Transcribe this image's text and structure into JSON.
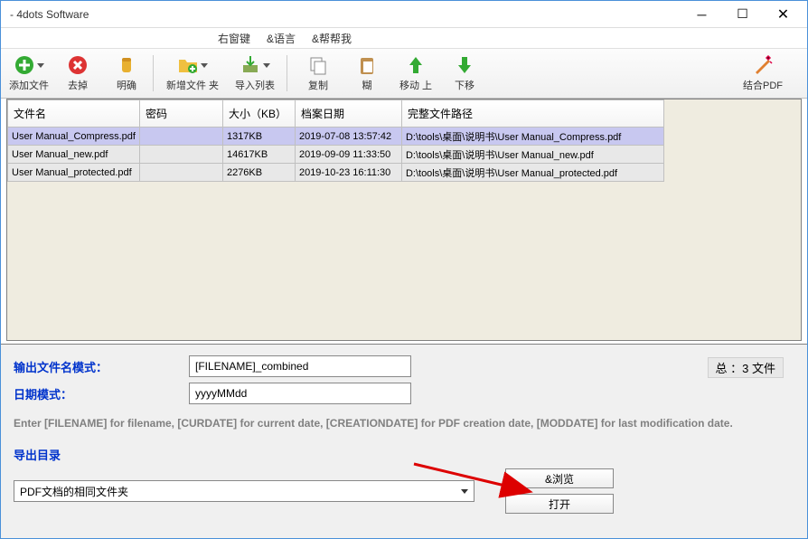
{
  "window": {
    "title": " - 4dots Software"
  },
  "menu": {
    "rightkey": "右窗键",
    "lang": "&语言",
    "help": "&帮帮我"
  },
  "toolbar": {
    "add": "添加文件",
    "remove": "去掉",
    "clear": "明确",
    "addfolder": "新增文件 夹",
    "importlist": "导入列表",
    "copy": "复制",
    "paste": "糊",
    "moveup": "移动 上",
    "movedown": "下移",
    "combine": "结合PDF"
  },
  "table": {
    "headers": {
      "filename": "文件名",
      "password": "密码",
      "size": "大小（KB）",
      "date": "档案日期",
      "path": "完整文件路径"
    },
    "rows": [
      {
        "name": "User Manual_Compress.pdf",
        "pw": "",
        "size": "1317KB",
        "date": "2019-07-08 13:57:42",
        "path": "D:\\tools\\桌面\\说明书\\User Manual_Compress.pdf",
        "selected": true
      },
      {
        "name": "User Manual_new.pdf",
        "pw": "",
        "size": "14617KB",
        "date": "2019-09-09 11:33:50",
        "path": "D:\\tools\\桌面\\说明书\\User Manual_new.pdf",
        "selected": false
      },
      {
        "name": "User Manual_protected.pdf",
        "pw": "",
        "size": "2276KB",
        "date": "2019-10-23 16:11:30",
        "path": "D:\\tools\\桌面\\说明书\\User Manual_protected.pdf",
        "selected": false
      }
    ]
  },
  "bottom": {
    "pattern_label": "输出文件名模式：",
    "pattern_value": "[FILENAME]_combined",
    "date_label": "日期模式：",
    "date_value": "yyyyMMdd",
    "count": "总 ：3 文件",
    "hint": "Enter [FILENAME] for filename, [CURDATE] for current date, [CREATIONDATE] for PDF creation date, [MODDATE] for last modification date.",
    "outdir_label": "导出目录",
    "outdir_value": "PDF文档的相同文件夹",
    "browse": "&浏览",
    "open": "打开"
  }
}
